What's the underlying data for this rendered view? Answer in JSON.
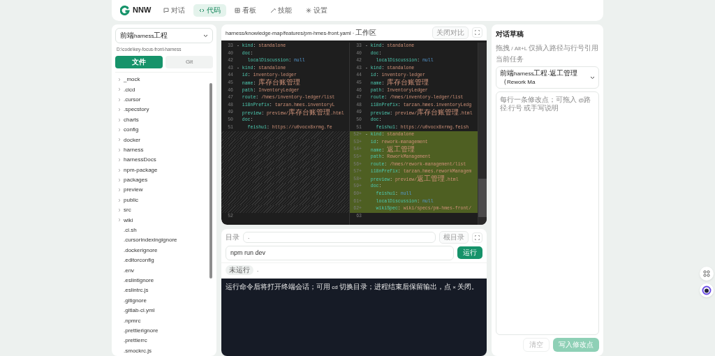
{
  "header": {
    "logo": "NNW",
    "nav": [
      {
        "label": "对话",
        "selected": false
      },
      {
        "label": "代码",
        "selected": true
      },
      {
        "label": "看板",
        "selected": false
      },
      {
        "label": "技能",
        "selected": false
      },
      {
        "label": "设置",
        "selected": false
      }
    ]
  },
  "sidebar": {
    "project": "前端harness工程",
    "path": "D:\\code\\key-focus-front-harness",
    "tabs": [
      {
        "label": "文件",
        "selected": true
      },
      {
        "label": "Git",
        "selected": false
      }
    ],
    "files": [
      {
        "name": "_mock",
        "kind": "folder"
      },
      {
        "name": ".cicd",
        "kind": "folder"
      },
      {
        "name": ".cursor",
        "kind": "folder"
      },
      {
        "name": ".specstory",
        "kind": "folder"
      },
      {
        "name": "charts",
        "kind": "folder"
      },
      {
        "name": "config",
        "kind": "folder"
      },
      {
        "name": "docker",
        "kind": "folder"
      },
      {
        "name": "harness",
        "kind": "folder"
      },
      {
        "name": "harnessDocs",
        "kind": "folder"
      },
      {
        "name": "npm-package",
        "kind": "folder"
      },
      {
        "name": "packages",
        "kind": "folder"
      },
      {
        "name": "preview",
        "kind": "folder"
      },
      {
        "name": "public",
        "kind": "folder"
      },
      {
        "name": "src",
        "kind": "folder"
      },
      {
        "name": "wiki",
        "kind": "folder"
      },
      {
        "name": ".ci.sh",
        "kind": "file"
      },
      {
        "name": ".cursorindexingignore",
        "kind": "file"
      },
      {
        "name": ".dockerignore",
        "kind": "file"
      },
      {
        "name": ".editorconfig",
        "kind": "file"
      },
      {
        "name": ".env",
        "kind": "file"
      },
      {
        "name": ".eslintignore",
        "kind": "file"
      },
      {
        "name": ".eslintrc.js",
        "kind": "file"
      },
      {
        "name": ".gitignore",
        "kind": "file"
      },
      {
        "name": ".gitlab-ci.yml",
        "kind": "file"
      },
      {
        "name": ".npmrc",
        "kind": "file"
      },
      {
        "name": ".prettierignore",
        "kind": "file"
      },
      {
        "name": ".prettierrc",
        "kind": "file"
      },
      {
        "name": ".smockrc.js",
        "kind": "file"
      }
    ]
  },
  "editor": {
    "path": "harness/knowledge-map/features/pm-hmes-front.yaml · 工作区",
    "close_button": "关闭对比",
    "rows": [
      {
        "left": {
          "no": "33",
          "text": "- kind: standalone"
        },
        "right": {
          "no": "33",
          "text": "- kind: standalone"
        }
      },
      {
        "left": {
          "no": "40",
          "text": "  doc:"
        },
        "right": {
          "no": "40",
          "text": "  doc:"
        }
      },
      {
        "left": {
          "no": "42",
          "text": "    localDiscussion: null"
        },
        "right": {
          "no": "42",
          "text": "    localDiscussion: null"
        }
      },
      {
        "left": {
          "no": "43",
          "text": "- kind: standalone"
        },
        "right": {
          "no": "43",
          "text": "- kind: standalone"
        }
      },
      {
        "left": {
          "no": "44",
          "text": "  id: inventory-ledger"
        },
        "right": {
          "no": "44",
          "text": "  id: inventory-ledger"
        }
      },
      {
        "left": {
          "no": "45",
          "text": "  name: 库存台账管理"
        },
        "right": {
          "no": "45",
          "text": "  name: 库存台账管理"
        }
      },
      {
        "left": {
          "no": "46",
          "text": "  path: InventoryLedger"
        },
        "right": {
          "no": "46",
          "text": "  path: InventoryLedger"
        }
      },
      {
        "left": {
          "no": "47",
          "text": "  route: /hmes/inventory-ledger/list"
        },
        "right": {
          "no": "47",
          "text": "  route: /hmes/inventory-ledger/list"
        }
      },
      {
        "left": {
          "no": "48",
          "text": "  i18nPrefix: tarzan.hmes.inventoryL"
        },
        "right": {
          "no": "48",
          "text": "  i18nPrefix: tarzan.hmes.inventoryLedg"
        }
      },
      {
        "left": {
          "no": "49",
          "text": "  preview: preview/库存台账管理.html"
        },
        "right": {
          "no": "49",
          "text": "  preview: preview/库存台账管理.html"
        }
      },
      {
        "left": {
          "no": "50",
          "text": "  doc:"
        },
        "right": {
          "no": "50",
          "text": "  doc:"
        }
      },
      {
        "left": {
          "no": "51",
          "text": "    feishu1: https://u0vocx8xrmg.fe"
        },
        "right": {
          "no": "51",
          "text": "    feishu1: https://u0vocx8xrmg.feish"
        }
      },
      {
        "right": {
          "no": "52",
          "marker": "+",
          "text": "- kind: standalone"
        }
      },
      {
        "right": {
          "no": "53",
          "marker": "+",
          "text": "  id: rework-management"
        }
      },
      {
        "right": {
          "no": "54",
          "marker": "+",
          "text": "  name: 返工管理"
        }
      },
      {
        "right": {
          "no": "55",
          "marker": "+",
          "text": "  path: ReworkManagement"
        }
      },
      {
        "right": {
          "no": "56",
          "marker": "+",
          "text": "  route: /hmes/rework-management/list"
        }
      },
      {
        "right": {
          "no": "57",
          "marker": "+",
          "text": "  i18nPrefix: tarzan.hmes.reworkManagem"
        }
      },
      {
        "right": {
          "no": "58",
          "marker": "+",
          "text": "  preview: preview/返工管理.html"
        }
      },
      {
        "right": {
          "no": "59",
          "marker": "+",
          "text": "  doc:"
        }
      },
      {
        "right": {
          "no": "60",
          "marker": "+",
          "text": "    feishu1: null"
        }
      },
      {
        "right": {
          "no": "61",
          "marker": "+",
          "text": "    localDiscussion: null"
        }
      },
      {
        "right": {
          "no": "62",
          "marker": "+",
          "text": "    wikiSpec: wiki/specs/pm-hmes-front/"
        }
      },
      {
        "left": {
          "no": "52"
        },
        "right": {
          "no": "63"
        }
      }
    ]
  },
  "terminal": {
    "dir_label": "目录",
    "dir_value": ".",
    "root_button": "根目录",
    "command": "npm run dev",
    "run_button": "运行",
    "status": "未运行",
    "status_path": ".",
    "output": "运行命令后将打开终端会话；可用 cd 切换目录；进程结束后保留输出，点 × 关闭。"
  },
  "draft": {
    "title": "对话草稿",
    "hint": "拖拽 / Alt+L 仅插入路径与行号引用",
    "task_label": "当前任务",
    "task": "前端harness工程-返工管理（Rework Ma",
    "placeholder": "每行一条修改点；可拖入 @路径:行号 或手写说明",
    "clear_button": "清空",
    "submit_button": "写入修改点",
    "submit_disabled": true
  }
}
